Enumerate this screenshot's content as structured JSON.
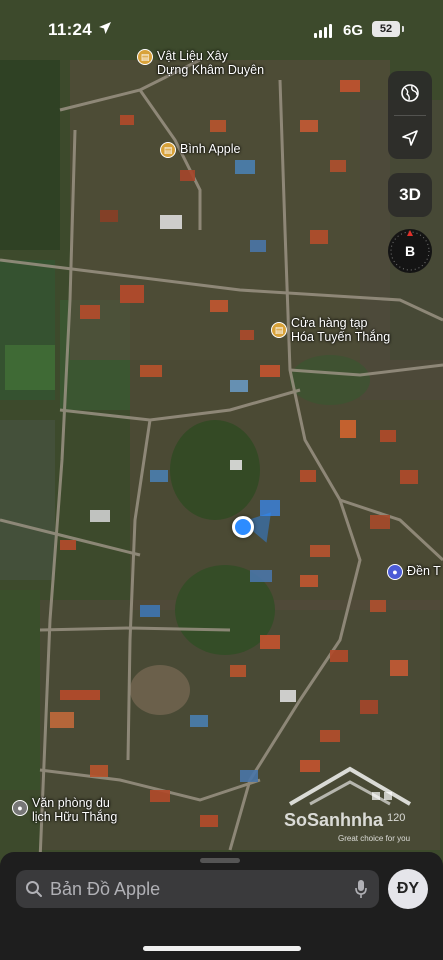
{
  "status_bar": {
    "time": "11:24",
    "network": "6G",
    "battery": "52"
  },
  "map_controls": {
    "three_d_label": "3D",
    "compass_label": "B"
  },
  "places": [
    {
      "id": "vat-lieu",
      "lines": [
        "Vật Liệu Xây",
        "Dựng Khâm Duyên"
      ],
      "kind": "shop"
    },
    {
      "id": "binh-apple",
      "lines": [
        "Bình Apple"
      ],
      "kind": "shop"
    },
    {
      "id": "cua-hang",
      "lines": [
        "Cửa hàng tạp",
        "Hóa Tuyến Thắng"
      ],
      "kind": "shop"
    },
    {
      "id": "den",
      "lines": [
        "Đền T"
      ],
      "kind": "landmark"
    },
    {
      "id": "van-phong",
      "lines": [
        "Văn phòng du",
        "lịch Hữu Thắng"
      ],
      "kind": "office"
    }
  ],
  "watermark": {
    "name": "SoSanhnha",
    "tagline": "Great choice for you",
    "scale_label": "120"
  },
  "search": {
    "placeholder": "Bản Đồ Apple",
    "avatar_initials": "ĐY"
  },
  "colors": {
    "user_location": "#2d8cff",
    "shop_pin": "#d8a23a",
    "landmark_pin": "#4b5bd6"
  }
}
